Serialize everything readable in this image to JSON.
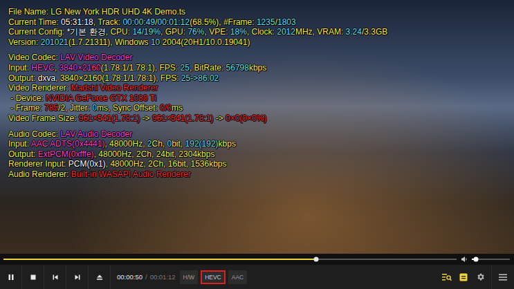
{
  "video": {
    "osd": {
      "groups": [
        [
          [
            {
              "text": "File Name: LG New York HDR UHD 4K Demo.ts",
              "color": "#f4ef3a"
            }
          ],
          [
            {
              "text": "Current Time: ",
              "color": "#f4ef3a"
            },
            {
              "text": "05:31:18",
              "color": "#ffffff"
            },
            {
              "text": ", Track: ",
              "color": "#f4ef3a"
            },
            {
              "text": "00:00:49",
              "color": "#5fe3f5"
            },
            {
              "text": "/",
              "color": "#f4ef3a"
            },
            {
              "text": "00:01:12",
              "color": "#5fe3f5"
            },
            {
              "text": "(68.5%), #Frame: ",
              "color": "#f4ef3a"
            },
            {
              "text": "1235",
              "color": "#5fe3f5"
            },
            {
              "text": "/",
              "color": "#f4ef3a"
            },
            {
              "text": "1803",
              "color": "#5fe3f5"
            }
          ],
          [
            {
              "text": "Current Config: ",
              "color": "#f4ef3a"
            },
            {
              "text": "*기본 환경",
              "color": "#ffffff"
            },
            {
              "text": ", CPU: ",
              "color": "#f4ef3a"
            },
            {
              "text": "14/19%",
              "color": "#5fe3f5"
            },
            {
              "text": ", GPU: ",
              "color": "#f4ef3a"
            },
            {
              "text": "76%",
              "color": "#5fe3f5"
            },
            {
              "text": ", VPE: ",
              "color": "#f4ef3a"
            },
            {
              "text": "18%",
              "color": "#5fe3f5"
            },
            {
              "text": ", Clock: ",
              "color": "#f4ef3a"
            },
            {
              "text": "2012",
              "color": "#5fe3f5"
            },
            {
              "text": "MHz, VRAM: ",
              "color": "#f4ef3a"
            },
            {
              "text": "3.24",
              "color": "#5fe3f5"
            },
            {
              "text": "/3.3GB",
              "color": "#f4ef3a"
            }
          ],
          [
            {
              "text": "Version: ",
              "color": "#f4ef3a"
            },
            {
              "text": "201021",
              "color": "#5fe3f5"
            },
            {
              "text": "(1.7.21311), Windows ",
              "color": "#f4ef3a"
            },
            {
              "text": "10",
              "color": "#5fe3f5"
            },
            {
              "text": " 2004(20H1/10.0.19041)",
              "color": "#f4ef3a"
            }
          ]
        ],
        [
          [
            {
              "text": "Video Codec: ",
              "color": "#f4ef3a"
            },
            {
              "text": "LAV Video Decoder",
              "color": "#ff3fd0"
            }
          ],
          [
            {
              "text": "Input: ",
              "color": "#f4ef3a"
            },
            {
              "text": "HEVC",
              "color": "#ff3fd0"
            },
            {
              "text": ", ",
              "color": "#f4ef3a"
            },
            {
              "text": "3840×2160",
              "color": "#ff3fd0"
            },
            {
              "text": "(1.78:1/1.78:1), FPS: ",
              "color": "#f4ef3a"
            },
            {
              "text": "25",
              "color": "#5fe3f5"
            },
            {
              "text": ", BitRate: ",
              "color": "#f4ef3a"
            },
            {
              "text": "56798",
              "color": "#5fe3f5"
            },
            {
              "text": "kbps",
              "color": "#f4ef3a"
            }
          ],
          [
            {
              "text": "Output: ",
              "color": "#f4ef3a"
            },
            {
              "text": "dxva",
              "color": "#ffffff"
            },
            {
              "text": ", 3840×2160(1.78:1/1.78:1), FPS: ",
              "color": "#f4ef3a"
            },
            {
              "text": "25->86.02",
              "color": "#5fe3f5"
            }
          ],
          [
            {
              "text": "Video Renderer: ",
              "color": "#f4ef3a"
            },
            {
              "text": "Madshi Video Renderer",
              "color": "#ff2a2a"
            }
          ],
          [
            {
              "text": " - Device: ",
              "color": "#f4ef3a"
            },
            {
              "text": "NVIDIA GeForce GTX 1080 Ti",
              "color": "#ff2a2a"
            }
          ],
          [
            {
              "text": " - Frame: ",
              "color": "#f4ef3a"
            },
            {
              "text": "785",
              "color": "#ff2a2a"
            },
            {
              "text": "/2, Jitter: ",
              "color": "#f4ef3a"
            },
            {
              "text": "0",
              "color": "#5fe3f5"
            },
            {
              "text": "ms, Sync Offset: ",
              "color": "#f4ef3a"
            },
            {
              "text": "0/0",
              "color": "#ff2a2a"
            },
            {
              "text": "ms",
              "color": "#f4ef3a"
            }
          ],
          [
            {
              "text": "Video Frame Size: ",
              "color": "#f4ef3a"
            },
            {
              "text": "961×541(1.78:1)",
              "color": "#ff2a2a"
            },
            {
              "text": " -> ",
              "color": "#f4ef3a"
            },
            {
              "text": "961×541(1.78:1)",
              "color": "#ff2a2a"
            },
            {
              "text": " -> ",
              "color": "#f4ef3a"
            },
            {
              "text": "0×0(0×0%)",
              "color": "#ff2a2a"
            }
          ]
        ],
        [
          [
            {
              "text": "Audio Codec: ",
              "color": "#f4ef3a"
            },
            {
              "text": "LAV Audio Decoder",
              "color": "#ff3fd0"
            }
          ],
          [
            {
              "text": "Input: ",
              "color": "#f4ef3a"
            },
            {
              "text": "AAC ADTS(0x4441)",
              "color": "#ff3fd0"
            },
            {
              "text": ", 48000Hz, ",
              "color": "#f4ef3a"
            },
            {
              "text": "2",
              "color": "#5fe3f5"
            },
            {
              "text": "Ch, ",
              "color": "#f4ef3a"
            },
            {
              "text": "0",
              "color": "#5fe3f5"
            },
            {
              "text": "bit, ",
              "color": "#f4ef3a"
            },
            {
              "text": "192(192)",
              "color": "#5fe3f5"
            },
            {
              "text": "kbps",
              "color": "#f4ef3a"
            }
          ],
          [
            {
              "text": "Output: ",
              "color": "#f4ef3a"
            },
            {
              "text": "ExtPCM(0xfffe)",
              "color": "#ff3fd0"
            },
            {
              "text": ", 48000Hz, 2Ch, 24bit, 2304kbps",
              "color": "#f4ef3a"
            }
          ],
          [
            {
              "text": "Renderer Input: ",
              "color": "#f4ef3a"
            },
            {
              "text": "PCM(0x1)",
              "color": "#ffffff"
            },
            {
              "text": ", 48000Hz, 2Ch, 16bit, 1536kbps",
              "color": "#f4ef3a"
            }
          ],
          [
            {
              "text": "Audio Renderer: ",
              "color": "#f4ef3a"
            },
            {
              "text": "Built-in WASAPI Audio Renderer",
              "color": "#ff2a2a"
            }
          ]
        ]
      ]
    }
  },
  "seek_bar": {
    "level": 0.69
  },
  "volume": {
    "level": 0.1
  },
  "time": {
    "current": "00:00:50",
    "separator": "/",
    "total": "00:01:12"
  },
  "badges": [
    {
      "label": "H/W",
      "selected": false
    },
    {
      "label": "HEVC",
      "selected": true
    },
    {
      "label": "AAC",
      "selected": false
    }
  ]
}
